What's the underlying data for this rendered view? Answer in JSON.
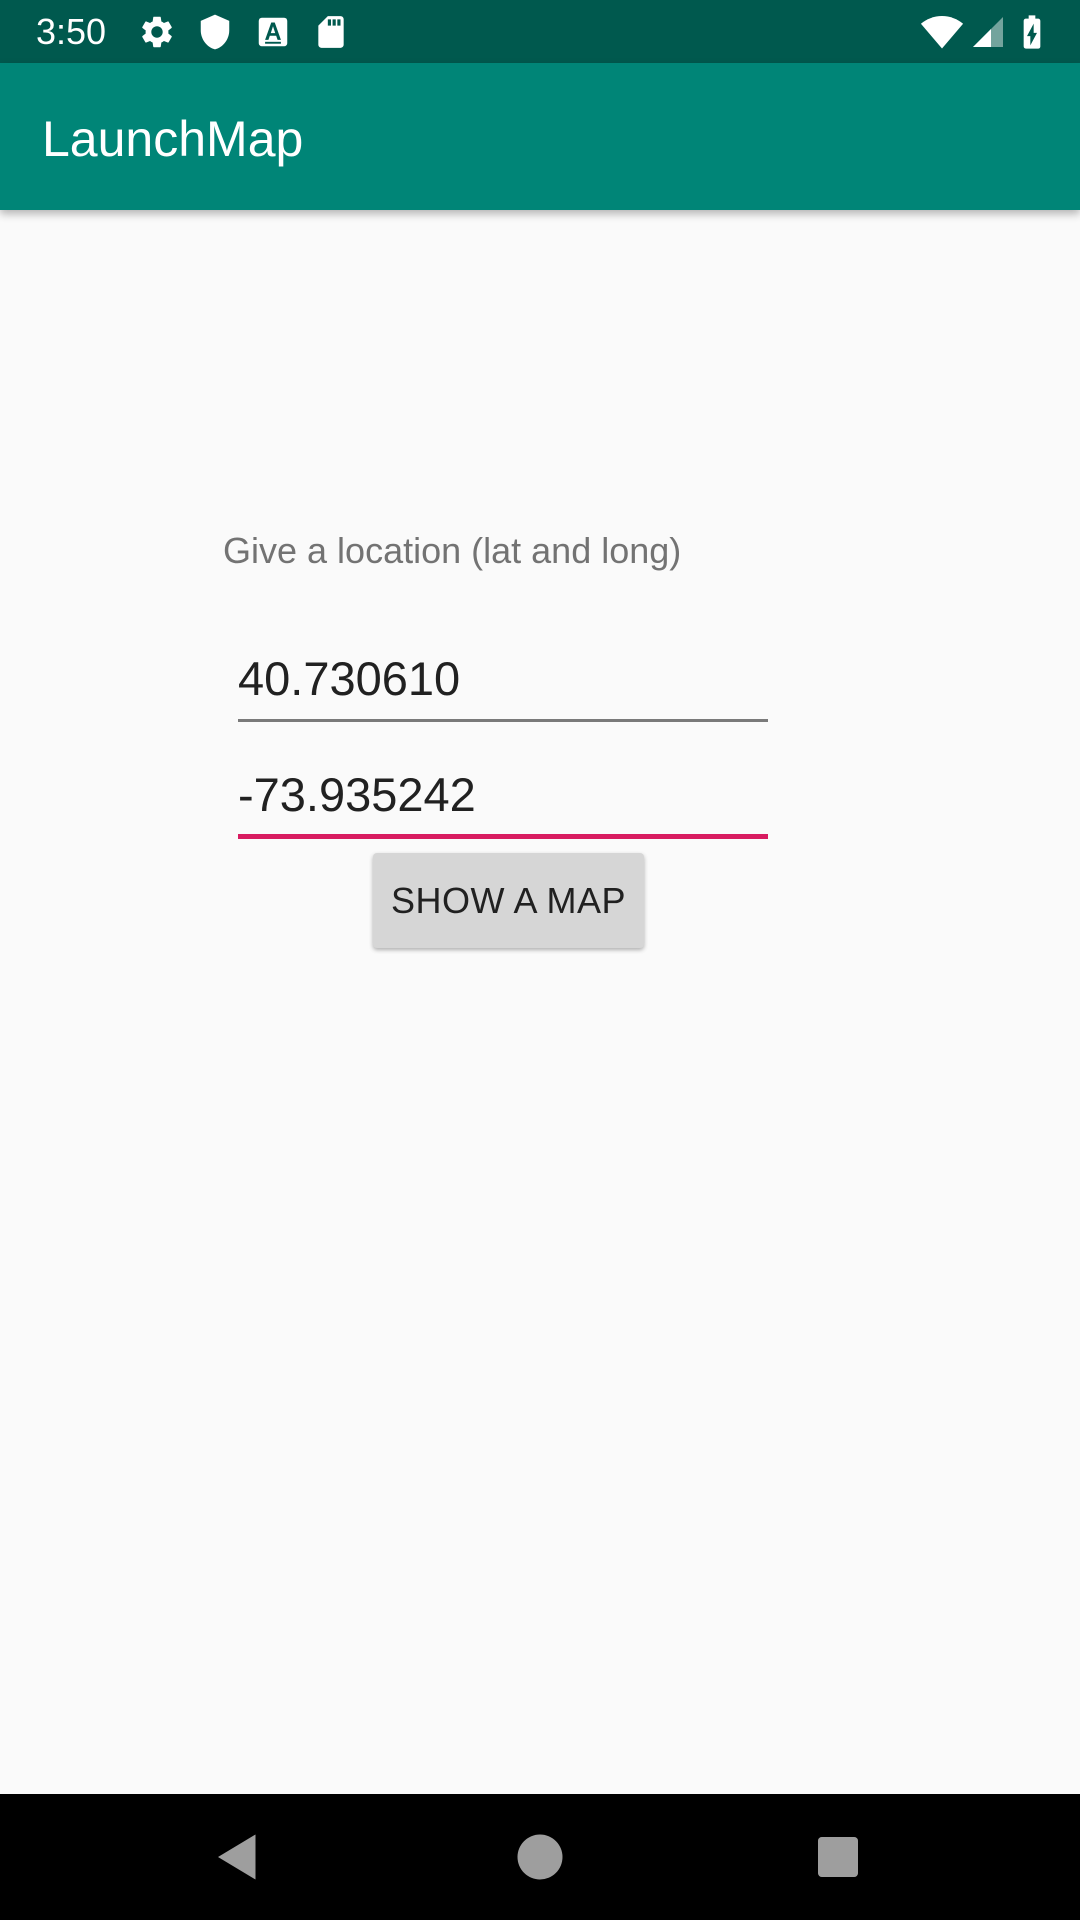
{
  "status_bar": {
    "time": "3:50",
    "left_icons": [
      "settings-icon",
      "shield-icon",
      "a-icon",
      "sd-card-icon"
    ],
    "right_icons": [
      "wifi-icon",
      "signal-icon",
      "battery-charging-icon"
    ],
    "color": "#00594E"
  },
  "app_bar": {
    "title": "LaunchMap",
    "color": "#008577"
  },
  "main": {
    "prompt": "Give a location (lat and long)",
    "latitude": {
      "value": "40.730610"
    },
    "longitude": {
      "value": "-73.935242",
      "focused": true,
      "accent": "#D81B60"
    },
    "button_label": "SHOW A MAP"
  },
  "nav_bar": {
    "buttons": [
      "back-icon",
      "home-icon",
      "recents-icon"
    ]
  }
}
